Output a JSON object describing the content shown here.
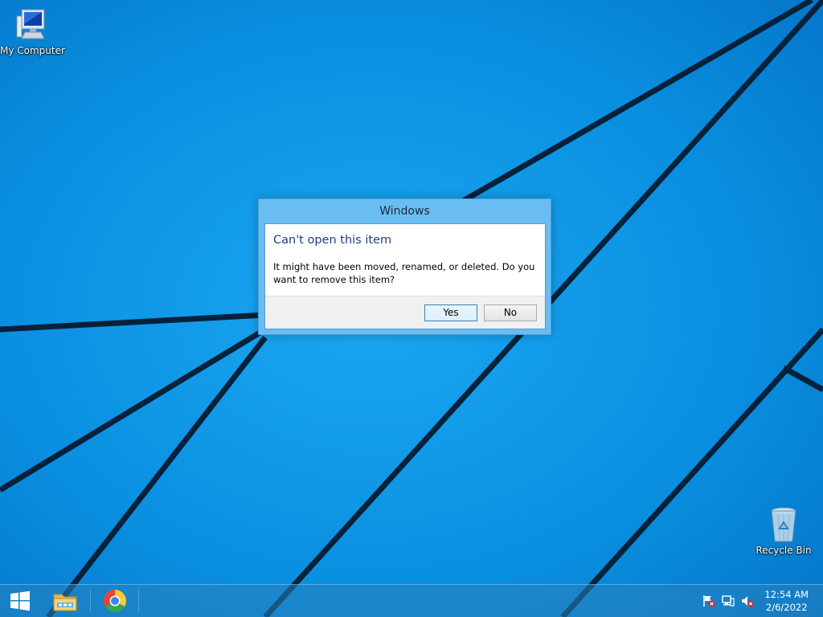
{
  "desktop": {
    "icons": [
      {
        "label": "My Computer",
        "icon": "computer-icon"
      },
      {
        "label": "Recycle Bin",
        "icon": "recycle-bin-icon"
      }
    ]
  },
  "dialog": {
    "title": "Windows",
    "heading": "Can't open this item",
    "message": "It might have been moved, renamed, or deleted. Do you want to remove this item?",
    "yes_label": "Yes",
    "no_label": "No",
    "accent_color": "#69bdf0",
    "heading_color": "#1e3c87"
  },
  "taskbar": {
    "start_icon": "windows-logo-icon",
    "pinned": [
      {
        "name": "File Explorer",
        "icon": "file-explorer-icon"
      },
      {
        "name": "Google Chrome",
        "icon": "chrome-icon"
      }
    ],
    "tray": [
      {
        "name": "Action Center",
        "icon": "flag-icon"
      },
      {
        "name": "Network",
        "icon": "network-icon"
      },
      {
        "name": "Volume",
        "icon": "volume-muted-icon"
      }
    ],
    "clock": {
      "time": "12:54 AM",
      "date": "2/6/2022"
    }
  },
  "colors": {
    "wallpaper": "#0a8fe0",
    "taskbar": "#2882be"
  }
}
